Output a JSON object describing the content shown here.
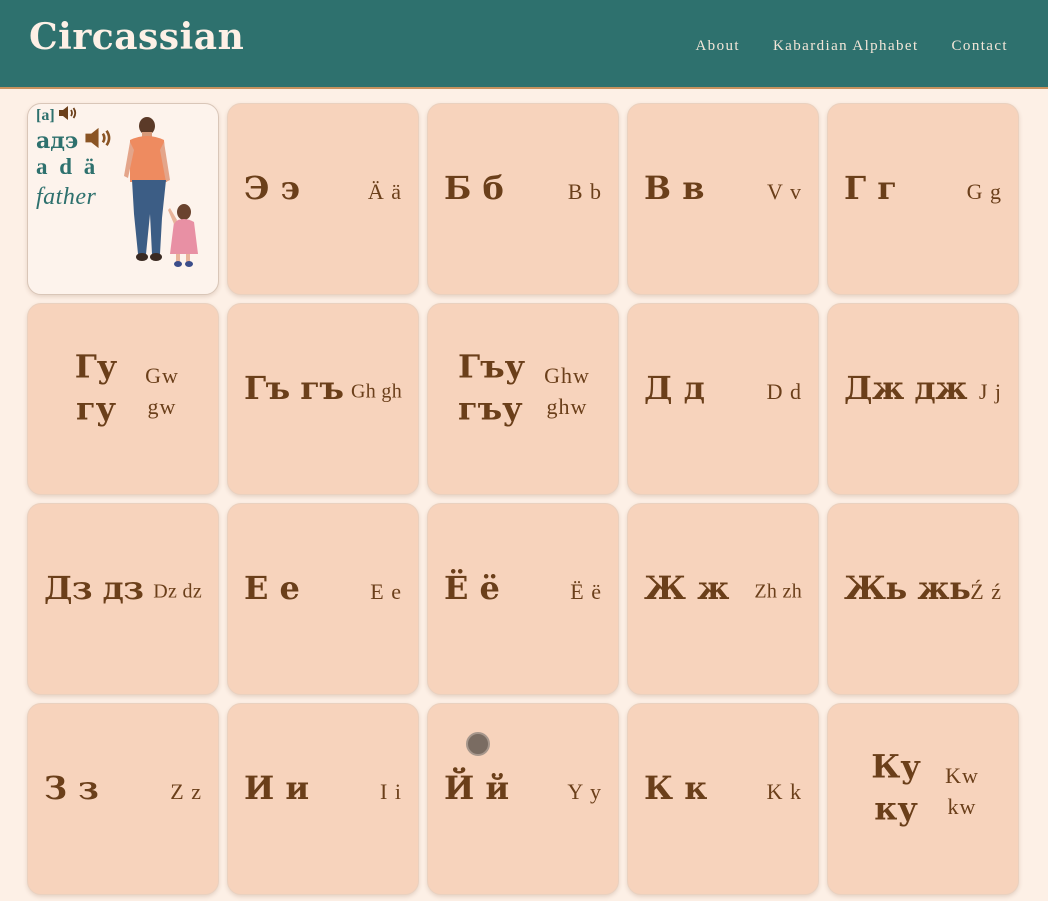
{
  "header": {
    "title": "Circassian",
    "nav": [
      "About",
      "Kabardian Alphabet",
      "Contact"
    ]
  },
  "feature": {
    "phonetic": "[a]",
    "word": "адэ",
    "transliteration": "a d ä",
    "meaning": "father",
    "speaker_icon": "speaker-icon",
    "illustration": "father-and-daughter-illustration"
  },
  "letters": [
    {
      "cyr": "Э э",
      "lat": "Ä ä"
    },
    {
      "cyr": "Б б",
      "lat": "B b"
    },
    {
      "cyr": "В в",
      "lat": "V v"
    },
    {
      "cyr": "Г г",
      "lat": "G g"
    },
    {
      "cyr": "Гу гу",
      "lat": "Gw gw"
    },
    {
      "cyr": "Гъ гъ",
      "lat": "Gh gh"
    },
    {
      "cyr": "Гъу гъу",
      "lat": "Ghw ghw"
    },
    {
      "cyr": "Д д",
      "lat": "D d"
    },
    {
      "cyr": "Дж дж",
      "lat": "J j"
    },
    {
      "cyr": "Дз дз",
      "lat": "Dz dz"
    },
    {
      "cyr": "Е е",
      "lat": "E e"
    },
    {
      "cyr": "Ё ё",
      "lat": "Ë ë"
    },
    {
      "cyr": "Ж ж",
      "lat": "Zh zh"
    },
    {
      "cyr": "Жь жь",
      "lat": "Ź ź"
    },
    {
      "cyr": "З з",
      "lat": "Z z"
    },
    {
      "cyr": "И и",
      "lat": "I i"
    },
    {
      "cyr": "Й й",
      "lat": "Y y"
    },
    {
      "cyr": "К к",
      "lat": "K k"
    },
    {
      "cyr": "Ку ку",
      "lat": "Kw kw"
    }
  ],
  "colors": {
    "header_bg": "#2e716e",
    "page_bg": "#fdf0e6",
    "card_bg": "#f7d3bc",
    "letter_text": "#6b3f1a",
    "feature_text": "#2e716e"
  }
}
